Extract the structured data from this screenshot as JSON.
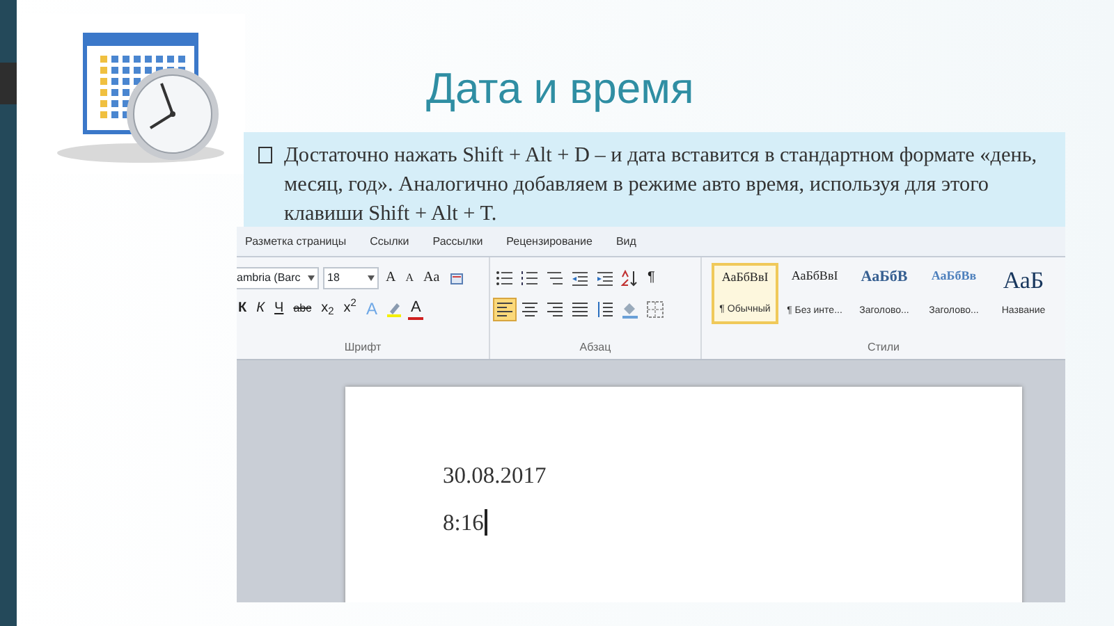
{
  "slide": {
    "title": "Дата и время",
    "bullet": "Достаточно нажать Shift + Alt + D – и дата вставится в стандартном формате «день, месяц, год». Аналогично добавляем в режиме авто время, используя для этого клавиши Shift + Alt + T."
  },
  "word": {
    "tabs": [
      "Разметка страницы",
      "Ссылки",
      "Рассылки",
      "Рецензирование",
      "Вид"
    ],
    "font_group": {
      "label": "Шрифт",
      "font_name": "ambria (Barc",
      "font_size": "18",
      "row1_buttons": [
        {
          "kind": "grow",
          "label": "A"
        },
        {
          "kind": "shrink",
          "label": "A"
        },
        {
          "kind": "case",
          "label": "Aa"
        },
        {
          "kind": "clear"
        }
      ],
      "row2_buttons": [
        {
          "kind": "bold",
          "label": "К"
        },
        {
          "kind": "italic",
          "label": "К"
        },
        {
          "kind": "underline",
          "label": "Ч"
        },
        {
          "kind": "strike",
          "label": "abc"
        },
        {
          "kind": "subscript",
          "label": "x$_{2}$"
        },
        {
          "kind": "superscript",
          "label": "x$^{2}$"
        },
        {
          "kind": "effects",
          "label": "A"
        },
        {
          "kind": "highlight"
        },
        {
          "kind": "color",
          "label": "A"
        }
      ]
    },
    "paragraph_group": {
      "label": "Абзац",
      "pilcrow": "¶",
      "align": [
        {
          "selected": true
        },
        {
          "selected": false
        },
        {
          "selected": false
        },
        {
          "selected": false
        }
      ]
    },
    "styles_group": {
      "label": "Стили",
      "styles": [
        {
          "kind": "normal",
          "sample": "АаБбВвI",
          "name": "¶ Обычный",
          "selected": true
        },
        {
          "kind": "normal",
          "sample": "АаБбВвI",
          "name": "¶ Без инте...",
          "selected": false
        },
        {
          "kind": "heading1",
          "sample": "АаБбВ",
          "name": "Заголово...",
          "selected": false
        },
        {
          "kind": "heading2",
          "sample": "АаБбВв",
          "name": "Заголово...",
          "selected": false
        },
        {
          "kind": "title",
          "sample": "АаБ",
          "name": "Название",
          "selected": false
        }
      ]
    },
    "document": {
      "lines": [
        "30.08.2017",
        "8:16"
      ],
      "cursor": true
    }
  }
}
